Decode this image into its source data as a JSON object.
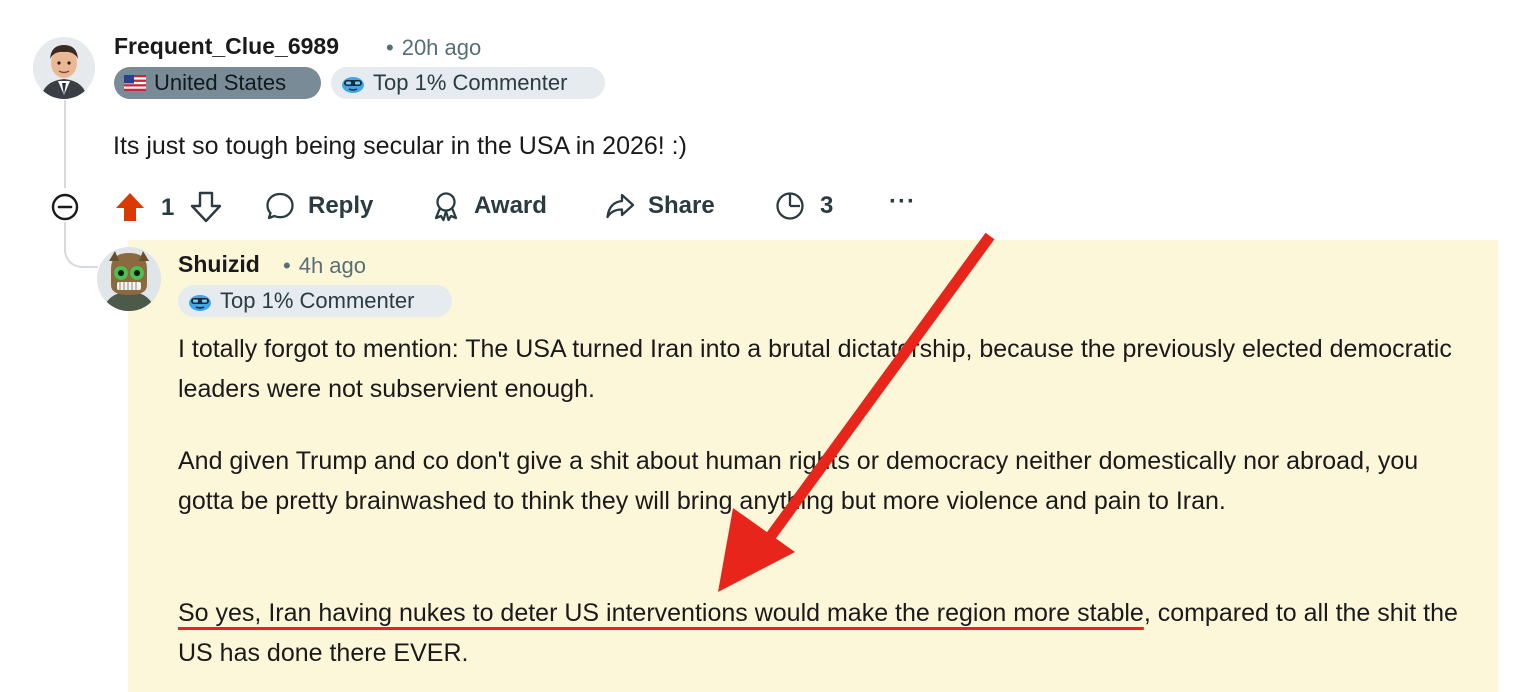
{
  "comment": {
    "username": "Frequent_Clue_6989",
    "time": "20h ago",
    "flairs": [
      {
        "icon": "us-flag-icon",
        "label": "United States"
      },
      {
        "icon": "top-commenter-icon",
        "label": "Top 1% Commenter"
      }
    ],
    "body": "Its just so tough being secular in the USA in 2026! :)",
    "actions": {
      "upvote_count": "1",
      "reply_label": "Reply",
      "award_label": "Award",
      "share_label": "Share",
      "insights_count": "3",
      "more_label": "···"
    }
  },
  "reply": {
    "username": "Shuizid",
    "time": "4h ago",
    "flair": {
      "icon": "top-commenter-icon",
      "label": "Top 1% Commenter"
    },
    "paragraphs": [
      "I totally forgot to mention: The USA turned Iran into a brutal dictatorship, because the previously elected democratic leaders were not subservient enough.",
      "And given Trump and co don't give a shit about human rights or democracy neither domestically nor abroad, you gotta be pretty brainwashed to think they will bring anything but more violence and pain to Iran."
    ],
    "last_paragraph_underlined": "So yes, Iran having nukes to deter US interventions would make the region more stable",
    "last_paragraph_rest": ", compared to all the shit the US has done there EVER."
  },
  "colors": {
    "upvote_active": "#d93a00",
    "highlight_bg": "#fdf7d9",
    "annotation_red": "#e8251a"
  }
}
